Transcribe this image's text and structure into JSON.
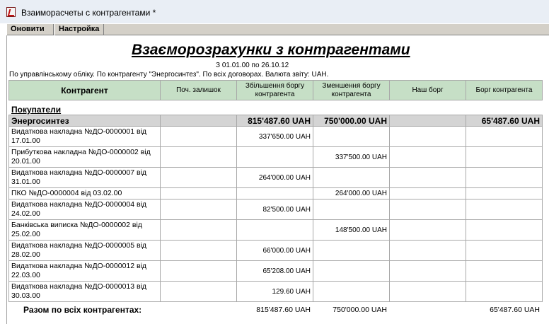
{
  "window": {
    "title": "Взаиморасчеты с контрагентами  *"
  },
  "toolbar": {
    "generate_label": "Оновити",
    "settings_label": "Настройка"
  },
  "report": {
    "title": "Взаєморозрахунки з контрагентами",
    "period": "З 01.01.00 по 26.10.12",
    "params": "По управлінському обліку. По контрагенту \"Энергосинтез\". По всіх договорах.  Валюта звіту: UAH."
  },
  "table": {
    "headers": {
      "counterparty": "Контрагент",
      "opening": "Поч. залишок",
      "increase": "Збільшення боргу контрагента",
      "decrease": "Зменшення боргу контрагента",
      "our_debt": "Наш борг",
      "cp_debt": "Борг контрагента"
    },
    "section": "Покупатели",
    "group": {
      "name": "Энергосинтез",
      "increase": "815'487.60 UAH",
      "decrease": "750'000.00 UAH",
      "cp_debt": "65'487.60 UAH"
    },
    "rows": [
      {
        "name": "Видаткова накладна №ДО-0000001 від 17.01.00",
        "increase": "337'650.00 UAH",
        "decrease": ""
      },
      {
        "name": "Прибуткова накладна №ДО-0000002 від 20.01.00",
        "increase": "",
        "decrease": "337'500.00 UAH"
      },
      {
        "name": "Видаткова накладна №ДО-0000007 від 31.01.00",
        "increase": "264'000.00 UAH",
        "decrease": ""
      },
      {
        "name": "ПКО №ДО-0000004 від 03.02.00",
        "increase": "",
        "decrease": "264'000.00 UAH"
      },
      {
        "name": "Видаткова накладна №ДО-0000004 від 24.02.00",
        "increase": "82'500.00 UAH",
        "decrease": ""
      },
      {
        "name": "Банківська виписка №ДО-0000002 від 25.02.00",
        "increase": "",
        "decrease": "148'500.00 UAH"
      },
      {
        "name": "Видаткова накладна №ДО-0000005 від 28.02.00",
        "increase": "66'000.00 UAH",
        "decrease": ""
      },
      {
        "name": "Видаткова накладна №ДО-0000012 від 22.03.00",
        "increase": "65'208.00 UAH",
        "decrease": ""
      },
      {
        "name": "Видаткова накладна №ДО-0000013 від 30.03.00",
        "increase": "129.60 UAH",
        "decrease": ""
      }
    ],
    "total": {
      "label": "Разом по всіх контрагентах:",
      "increase": "815'487.60 UAH",
      "decrease": "750'000.00 UAH",
      "cp_debt": "65'487.60 UAH"
    }
  }
}
